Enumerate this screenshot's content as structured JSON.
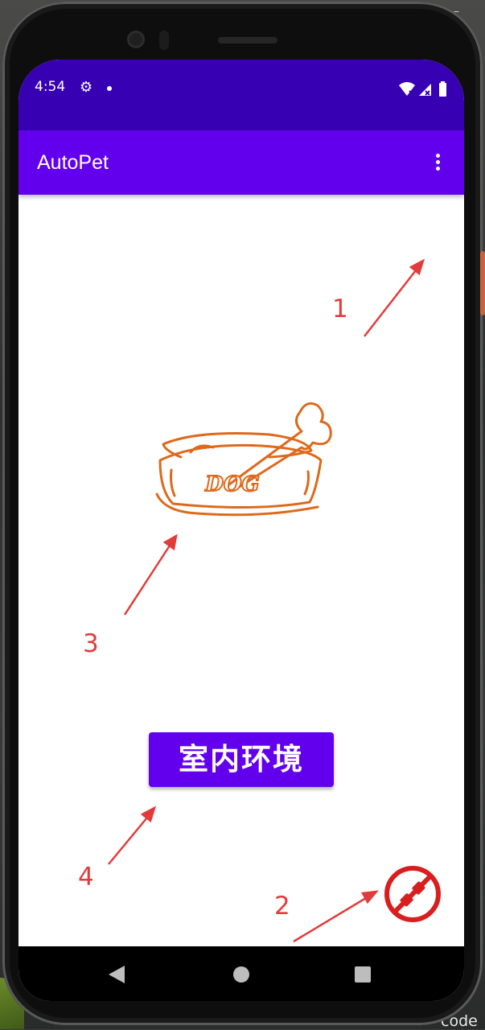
{
  "status_bar": {
    "time": "4:54"
  },
  "app_bar": {
    "title": "AutoPet",
    "overflow_icon": "more-vert-icon"
  },
  "content": {
    "bowl_label": "DOG",
    "environment_button": "室内环境",
    "fab_icon": "plug-disconnected-icon"
  },
  "annotations": {
    "label_1": "1",
    "label_2": "2",
    "label_3": "3",
    "label_4": "4",
    "color": "#e23b3b"
  },
  "colors": {
    "status_bar": "#3700b3",
    "app_bar": "#6200ee",
    "bowl_stroke": "#dd6a1c",
    "fab_red": "#d81e1e"
  },
  "desktop": {
    "bottom_text": "code",
    "corner_text": "ㄷ"
  }
}
